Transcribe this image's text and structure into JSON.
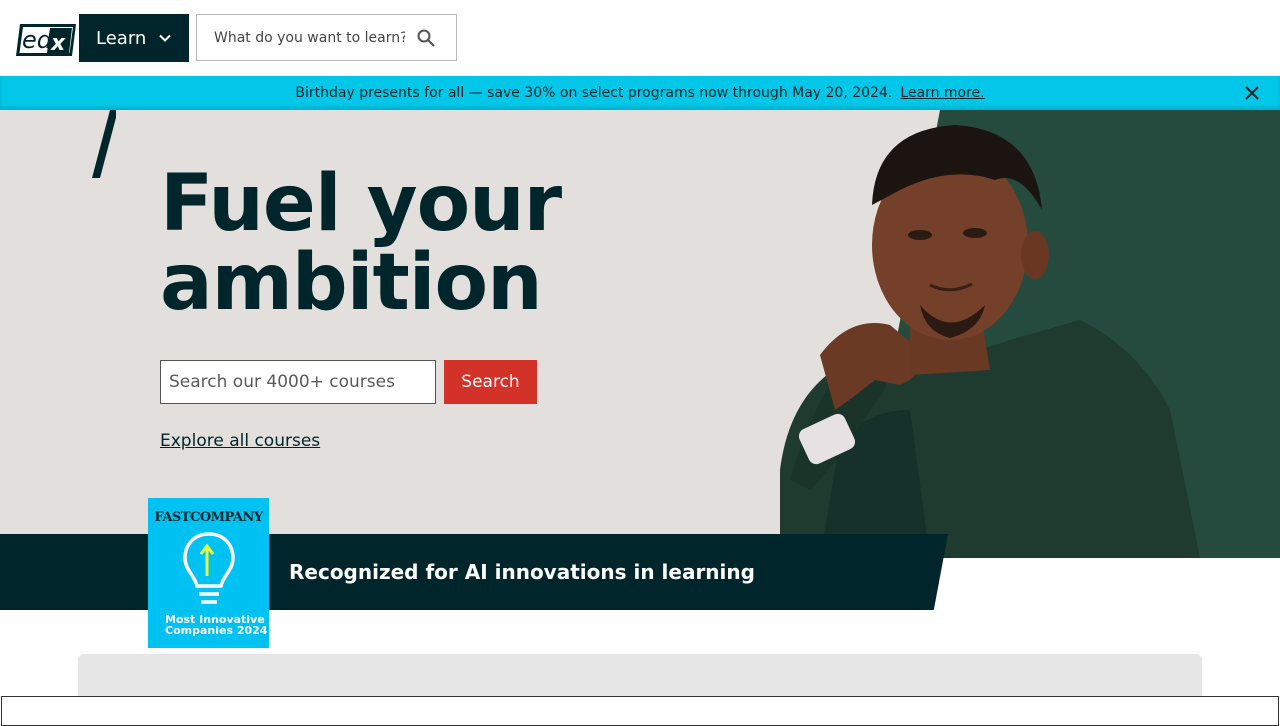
{
  "header": {
    "logo_text": "edX",
    "learn_label": "Learn",
    "search_placeholder": "What do you want to learn?"
  },
  "banner": {
    "message": "Birthday presents for all — save 30% on select programs now through May 20, 2024.",
    "link_label": "Learn more."
  },
  "hero": {
    "title_line1": "Fuel your",
    "title_line2": "ambition",
    "search_placeholder": "Search our 4000+ courses",
    "search_button": "Search",
    "explore_link": "Explore all courses"
  },
  "award": {
    "badge_brand": "FASTCOMPANY",
    "badge_line1": "Most Innovative",
    "badge_line2": "Companies 2024",
    "text": "Recognized for AI innovations in learning"
  },
  "colors": {
    "brand_dark": "#00262b",
    "banner": "#03c7e8",
    "cta_red": "#d23228",
    "hero_bg": "#e2dfdd",
    "green_panel": "#254a3e"
  },
  "icons": {
    "learn_chevron": "chevron-down-icon",
    "header_search": "search-icon",
    "banner_close": "close-icon",
    "badge_art": "lightbulb-icon"
  }
}
